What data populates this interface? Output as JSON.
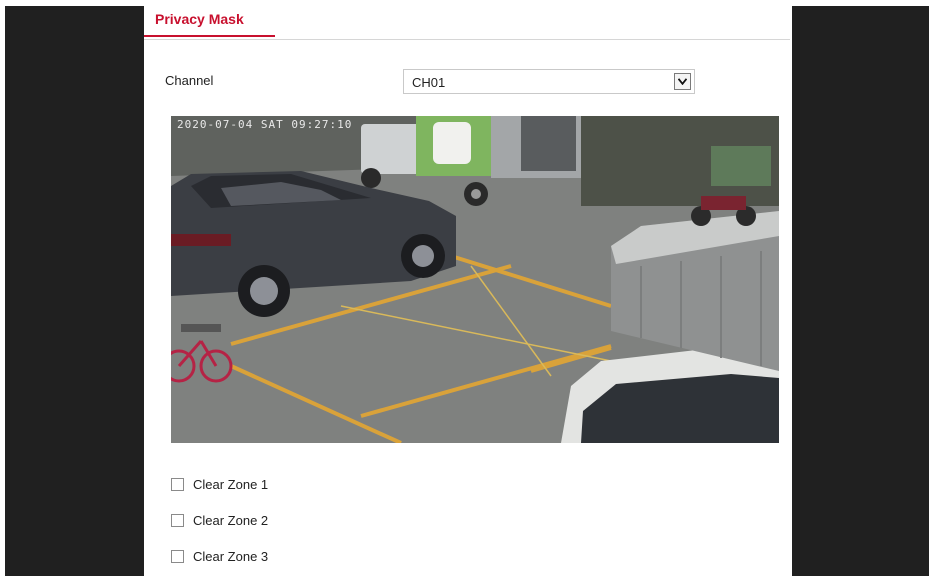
{
  "tab": {
    "label": "Privacy Mask"
  },
  "channel": {
    "label": "Channel",
    "value": "CH01"
  },
  "video": {
    "osd": "2020-07-04 SAT 09:27:10"
  },
  "zones": [
    {
      "label": "Clear Zone 1",
      "checked": false
    },
    {
      "label": "Clear Zone 2",
      "checked": false
    },
    {
      "label": "Clear Zone 3",
      "checked": false
    }
  ],
  "colors": {
    "accent": "#c8102e",
    "side": "#202020"
  }
}
